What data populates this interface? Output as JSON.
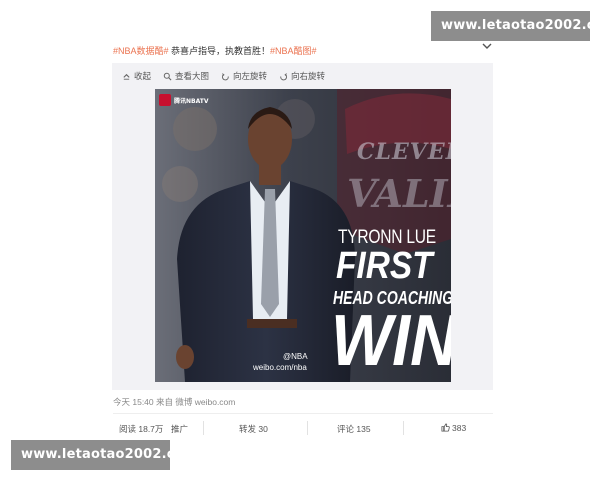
{
  "watermark": {
    "text": "www.letaotao2002.com"
  },
  "post": {
    "tag_data": "#NBA数据酷#",
    "body": " 恭喜卢指导，执教首胜！",
    "tag_pic": "#NBA酷图#"
  },
  "toolbar": {
    "collapse": "收起",
    "view_large": "查看大图",
    "rotate_left": "向左旋转",
    "rotate_right": "向右旋转"
  },
  "image": {
    "channel_logo": "腾讯NBATV",
    "team_text": "CLEVEL",
    "team_text2": "VALIE",
    "name": "TYRONN LUE",
    "line1": "FIRST",
    "line2": "HEAD COACHING",
    "line3": "WIN",
    "credit_handle": "@NBA",
    "credit_url": "weibo.com/nba"
  },
  "meta": {
    "time": "今天 15:40",
    "from_label": " 来自 ",
    "via": "微博 weibo.com"
  },
  "actions": {
    "read": "阅读 18.7万",
    "promote": "推广",
    "repost": "转发 30",
    "comment": "评论 135",
    "like": "383"
  },
  "colors": {
    "link": "#eb7350",
    "watermark_bg": "#8d8d8d",
    "media_bg": "#f2f2f5"
  }
}
